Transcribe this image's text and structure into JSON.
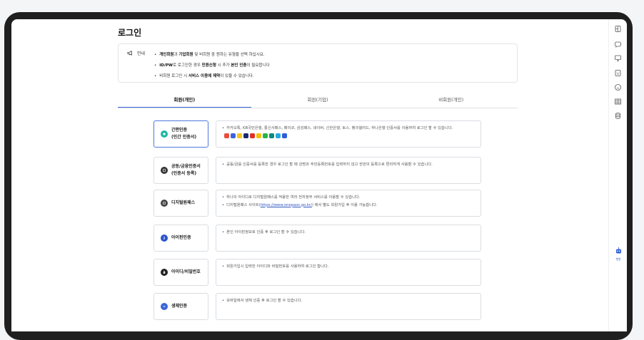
{
  "page": {
    "title": "로그인"
  },
  "notice": {
    "label": "안내",
    "lines": [
      {
        "b1": "개인회원",
        "t1": "과 ",
        "b2": "기업회원",
        "t2": " 및 비회원 중 원하는 유형을 선택 하십시요."
      },
      {
        "b1": "ID/PW",
        "t1": "로 로그인한 경우 ",
        "b2": "민원신청",
        "t2": " 시 추가 ",
        "b3": "본인 인증",
        "t3": "이 필요합니다"
      },
      {
        "t0": "비회원 로그인 시 ",
        "b1": "서비스 이용에 제약",
        "t1": "이 있을 수 있습니다."
      }
    ]
  },
  "tabs": [
    "회원(개인)",
    "회원(기업)",
    "비회원(개인)"
  ],
  "methods": [
    {
      "label": "간편인증\n(민간 인증서)",
      "icon": "simple-auth-icon",
      "desc": [
        "카카오톡, KB국민은행, 통신사패스, 페이코, 삼성패스, 네이버, 신한은행, 토스, 뱅크샐러드, 하나은행 인증서를 이용하여 로그인 할 수 있습니다."
      ]
    },
    {
      "label": "공동/금융인증서\n(인증서 등록)",
      "icon": "certificate-icon",
      "desc": [
        "공동/금융 인증서를 등록한 경우 로그인 할 때 성명과 주민등록번호를 입력하지 않고 한번의 등록으로 편리하게 사용할 수 있습니다."
      ]
    },
    {
      "label": "디지털원패스",
      "icon": "digital-onepass-icon",
      "desc": [
        "하나의 아이디로 디지털원패스를 적용한 여러 전자정부 서비스를 이용할 수 있습니다."
      ],
      "desc2_pre": "디지털원패스 사이트(",
      "desc2_link": "https://www.onepass.go.kr/",
      "desc2_post": ") 에서 별도 회원가입 후 이용 가능합니다."
    },
    {
      "label": "아이핀인증",
      "icon": "ipin-icon",
      "desc": [
        "본인 아이핀정보로 인증 후 로그인 할 수 있습니다."
      ]
    },
    {
      "label": "아이디/비밀번호",
      "icon": "lock-icon",
      "desc": [
        "회원가입시 입력한 아이디와 비밀번호를 사용하여 로그인 합니다."
      ]
    },
    {
      "label": "생체인증",
      "icon": "biometric-icon",
      "desc": [
        "모바일에서 생체 인증 후 로그인 할 수 있습니다."
      ]
    }
  ],
  "chatbot": {
    "label": "챗봇"
  },
  "colors": {
    "accent": "#3a64d8",
    "border": "#d9dde2"
  }
}
